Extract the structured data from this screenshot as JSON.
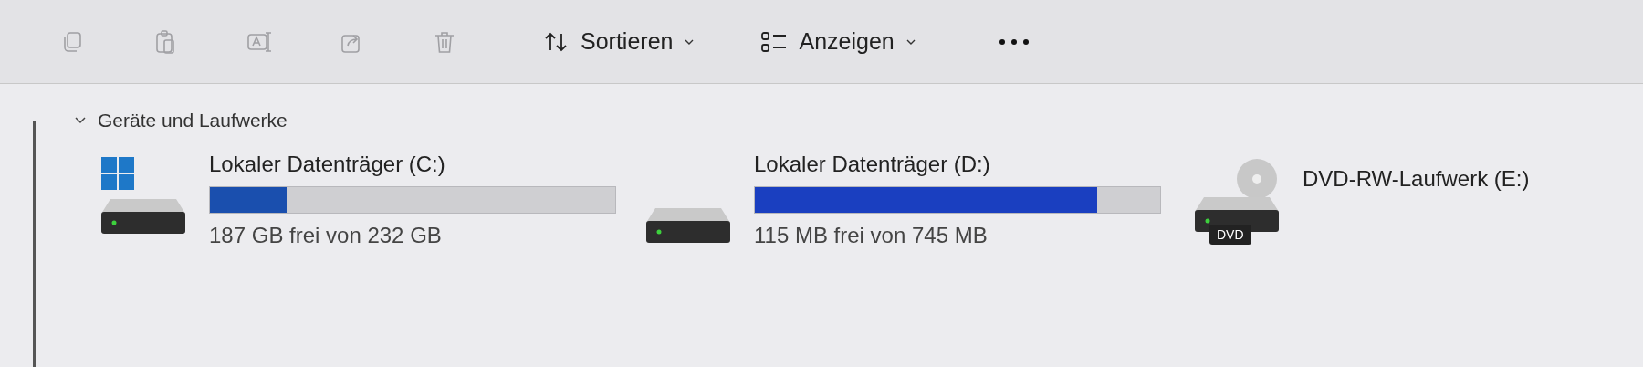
{
  "toolbar": {
    "buttons": [
      {
        "kind": "copy",
        "disabled": true
      },
      {
        "kind": "paste",
        "disabled": true
      },
      {
        "kind": "rename",
        "disabled": true
      },
      {
        "kind": "share",
        "disabled": true
      },
      {
        "kind": "delete",
        "disabled": true
      }
    ],
    "sort": {
      "label": "Sortieren"
    },
    "view": {
      "label": "Anzeigen"
    }
  },
  "section": {
    "title": "Geräte und Laufwerke",
    "expanded": true,
    "drives": [
      {
        "kind": "disk",
        "system": true,
        "name": "Lokaler Datenträger (C:)",
        "level": 0.19,
        "free": "187 GB frei von 232 GB"
      },
      {
        "kind": "disk",
        "system": false,
        "name": "Lokaler Datenträger (D:)",
        "level": 0.845,
        "free": "115 MB frei von 745 MB"
      },
      {
        "kind": "dvd",
        "name": "DVD-RW-Laufwerk (E:)",
        "badge": "DVD"
      }
    ]
  }
}
